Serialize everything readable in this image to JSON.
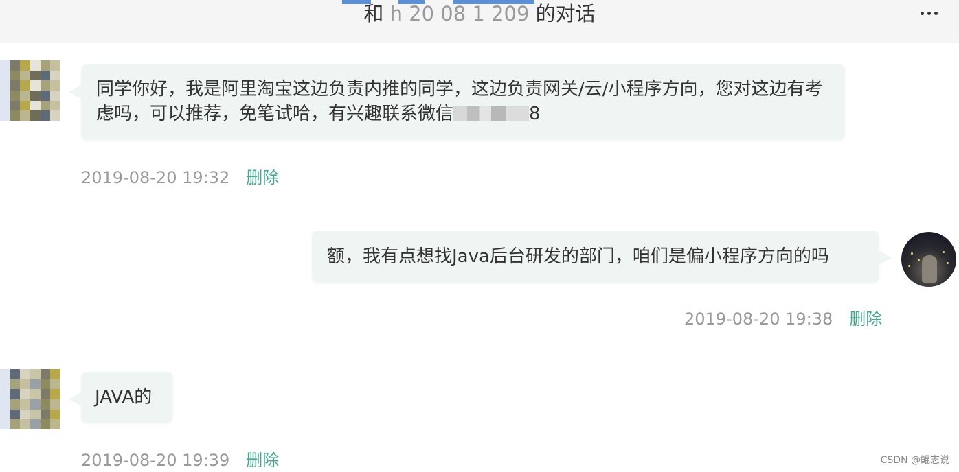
{
  "header": {
    "title_prefix": "和",
    "username_visible": "h  20  08  1  209",
    "title_suffix": "的对话",
    "more_icon": "more-dots-icon"
  },
  "messages": [
    {
      "side": "left",
      "text": "同学你好，我是阿里淘宝这边负责内推的同学，这边负责网关/云/小程序方向，您对这边有考虑吗，可以推荐，免笔试哈，有兴趣联系微信",
      "text_tail": "8",
      "time": "2019-08-20 19:32",
      "delete_label": "删除"
    },
    {
      "side": "right",
      "text": "额，我有点想找Java后台研发的部门，咱们是偏小程序方向的吗",
      "time": "2019-08-20 19:38",
      "delete_label": "删除"
    },
    {
      "side": "left",
      "text": "JAVA的",
      "time": "2019-08-20 19:39",
      "delete_label": "删除"
    }
  ],
  "watermark": "CSDN @鲲志说",
  "colors": {
    "bubble": "#eef5f3",
    "delete_link": "#4aa58f",
    "timestamp": "#999999",
    "header_bg": "#f5f5f5"
  }
}
